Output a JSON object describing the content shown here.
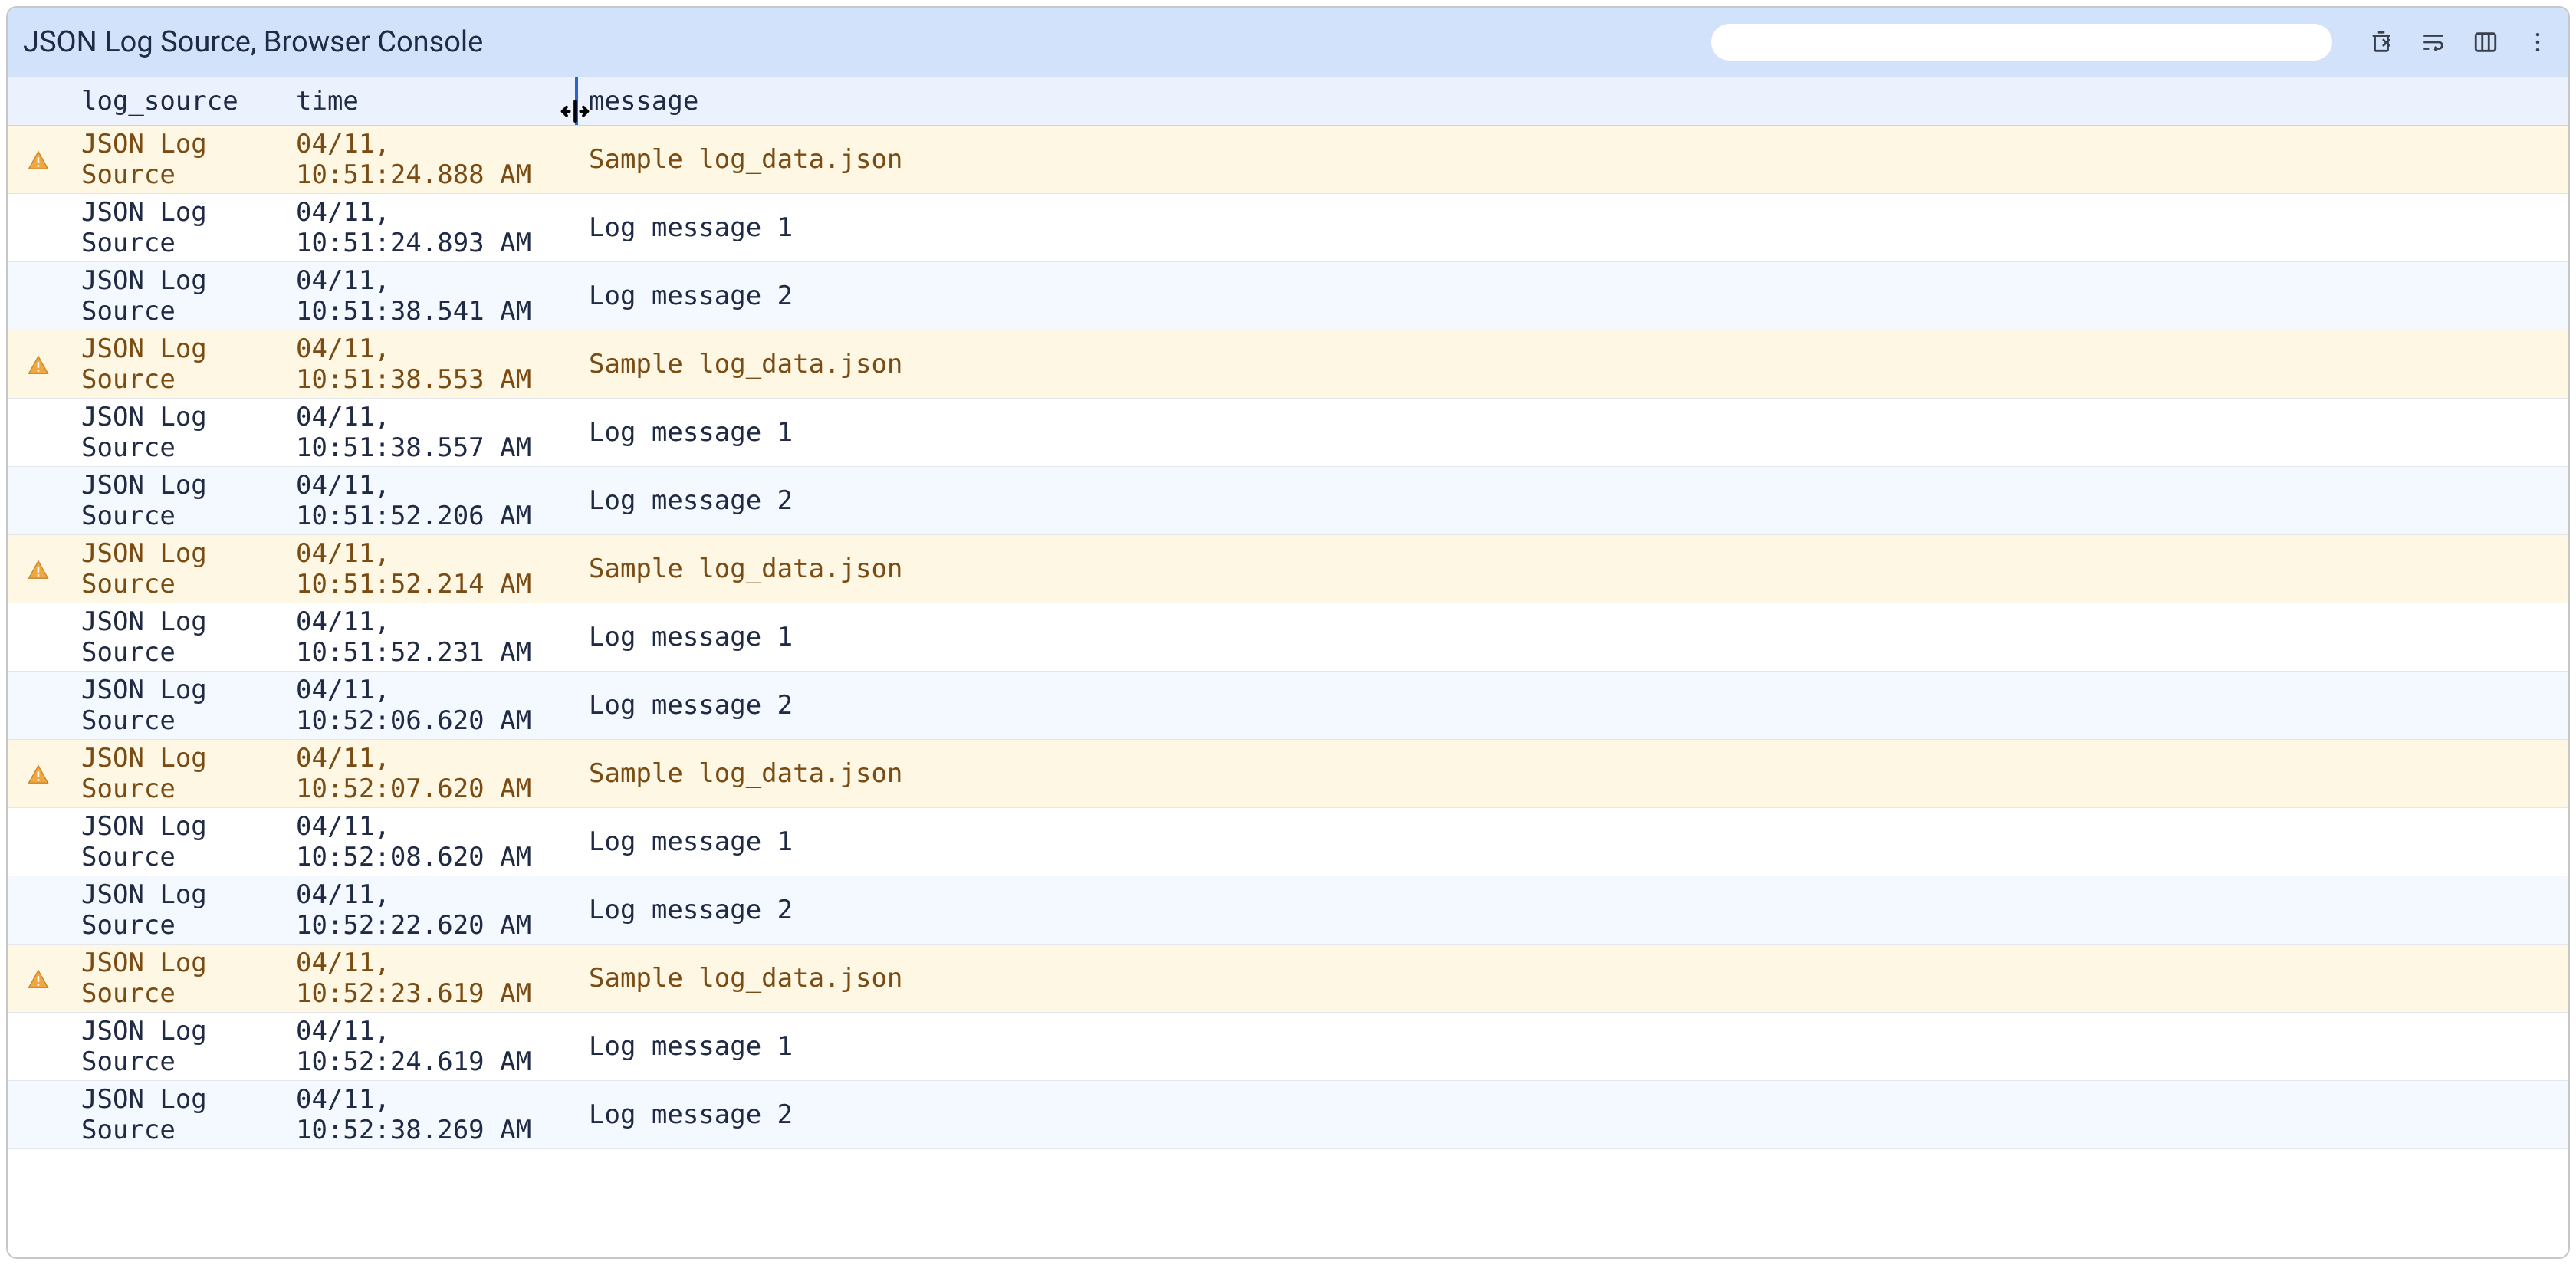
{
  "header": {
    "title": "JSON Log Source, Browser Console",
    "search_placeholder": ""
  },
  "columns": {
    "icon": "",
    "log_source": "log_source",
    "time": "time",
    "message": "message"
  },
  "rows": [
    {
      "level": "warn",
      "source": "JSON Log Source",
      "time": "04/11, 10:51:24.888 AM",
      "message": "Sample log_data.json"
    },
    {
      "level": "normal",
      "source": "JSON Log Source",
      "time": "04/11, 10:51:24.893 AM",
      "message": "Log message 1"
    },
    {
      "level": "normal",
      "source": "JSON Log Source",
      "time": "04/11, 10:51:38.541 AM",
      "message": "Log message 2"
    },
    {
      "level": "warn",
      "source": "JSON Log Source",
      "time": "04/11, 10:51:38.553 AM",
      "message": "Sample log_data.json"
    },
    {
      "level": "normal",
      "source": "JSON Log Source",
      "time": "04/11, 10:51:38.557 AM",
      "message": "Log message 1"
    },
    {
      "level": "normal",
      "source": "JSON Log Source",
      "time": "04/11, 10:51:52.206 AM",
      "message": "Log message 2"
    },
    {
      "level": "warn",
      "source": "JSON Log Source",
      "time": "04/11, 10:51:52.214 AM",
      "message": "Sample log_data.json"
    },
    {
      "level": "normal",
      "source": "JSON Log Source",
      "time": "04/11, 10:51:52.231 AM",
      "message": "Log message 1"
    },
    {
      "level": "normal",
      "source": "JSON Log Source",
      "time": "04/11, 10:52:06.620 AM",
      "message": "Log message 2"
    },
    {
      "level": "warn",
      "source": "JSON Log Source",
      "time": "04/11, 10:52:07.620 AM",
      "message": "Sample log_data.json"
    },
    {
      "level": "normal",
      "source": "JSON Log Source",
      "time": "04/11, 10:52:08.620 AM",
      "message": "Log message 1"
    },
    {
      "level": "normal",
      "source": "JSON Log Source",
      "time": "04/11, 10:52:22.620 AM",
      "message": "Log message 2"
    },
    {
      "level": "warn",
      "source": "JSON Log Source",
      "time": "04/11, 10:52:23.619 AM",
      "message": "Sample log_data.json"
    },
    {
      "level": "normal",
      "source": "JSON Log Source",
      "time": "04/11, 10:52:24.619 AM",
      "message": "Log message 1"
    },
    {
      "level": "normal",
      "source": "JSON Log Source",
      "time": "04/11, 10:52:38.269 AM",
      "message": "Log message 2"
    }
  ]
}
